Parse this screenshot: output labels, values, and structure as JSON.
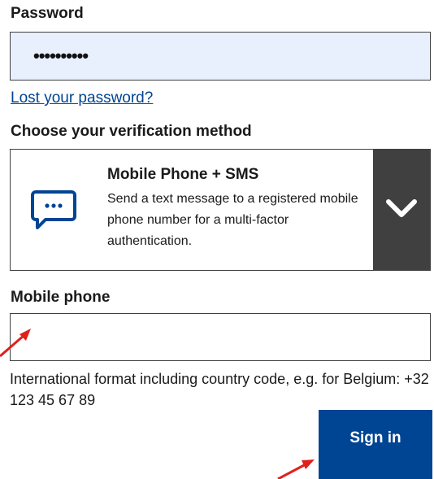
{
  "password": {
    "label": "Password",
    "value": "••••••••••"
  },
  "lost_password_link": "Lost your password?",
  "verification": {
    "label": "Choose your verification method",
    "selected_title": "Mobile Phone + SMS",
    "selected_description": "Send a text message to a registered mobile phone number for a multi-factor authentication.",
    "icon": "sms-chat-icon",
    "toggle_icon": "chevron-down-icon"
  },
  "mobile_phone": {
    "label": "Mobile phone",
    "value": "",
    "hint": "International format including country code, e.g. for Belgium: +32 123 45 67 89"
  },
  "sign_in_button": "Sign in",
  "colors": {
    "primary": "#004494",
    "field_autofill": "#e8f0fe",
    "toggle_bg": "#404040",
    "annotation_arrow": "#e0201b"
  }
}
